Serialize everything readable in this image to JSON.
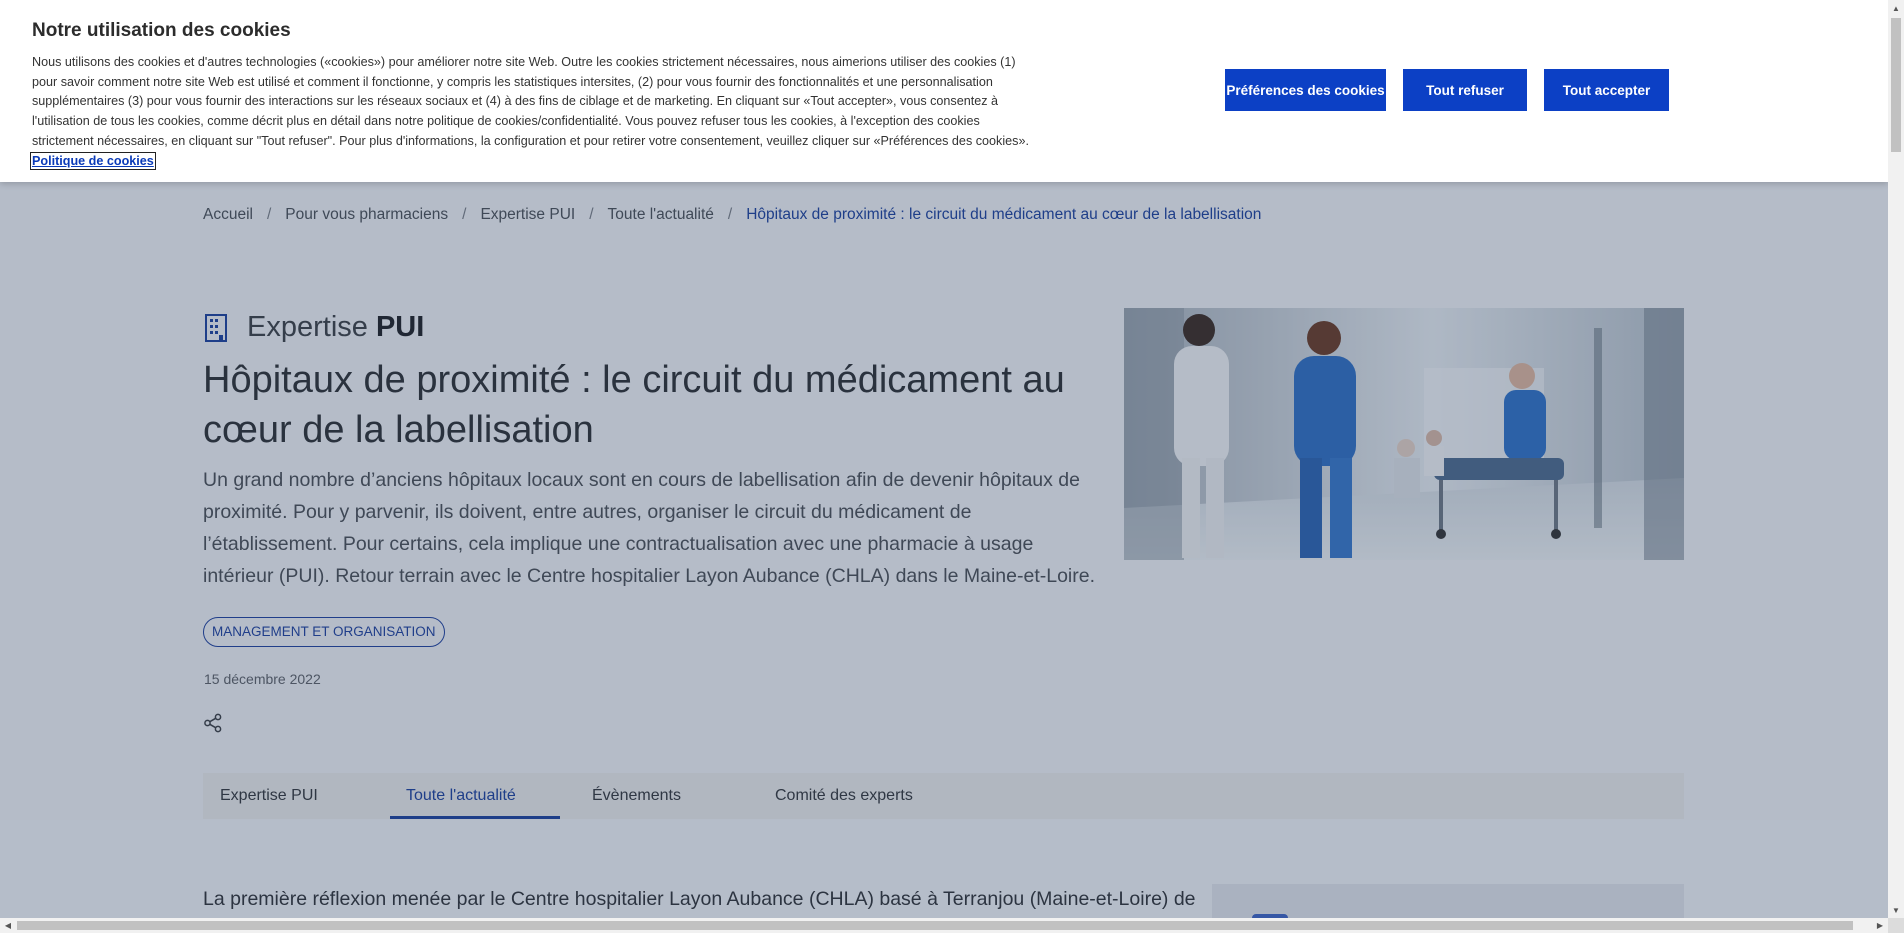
{
  "cookie_banner": {
    "title": "Notre utilisation des cookies",
    "text": "Nous utilisons des cookies et d'autres technologies («cookies») pour améliorer notre site Web. Outre les cookies strictement nécessaires, nous aimerions utiliser des cookies (1) pour savoir comment notre site Web est utilisé et comment il fonctionne, y compris les statistiques intersites, (2) pour vous fournir des fonctionnalités et une personnalisation supplémentaires (3) pour vous fournir des interactions sur les réseaux sociaux et (4) à des fins de ciblage et de marketing. En cliquant sur «Tout accepter», vous consentez à l'utilisation de tous les cookies, comme décrit plus en détail dans notre politique de cookies/confidentialité. Vous pouvez refuser tous les cookies, à l'exception des cookies strictement nécessaires, en cliquant sur \"Tout refuser\". Pour plus d'informations, la configuration et pour retirer votre consentement, veuillez cliquer sur «Préférences des cookies».",
    "policy_link": "Politique de cookies",
    "btn_preferences": "Préférences des cookies",
    "btn_refuse": "Tout refuser",
    "btn_accept": "Tout accepter"
  },
  "breadcrumb": {
    "items": [
      "Accueil",
      "Pour vous pharmaciens",
      "Expertise PUI",
      "Toute l'actualité"
    ],
    "current": "Hôpitaux de proximité : le circuit du médicament au cœur de la labellisation",
    "separator": "/"
  },
  "article": {
    "category_prefix": "Expertise",
    "category_strong": "PUI",
    "title": "Hôpitaux de proximité : le circuit du médicament au cœur de la labellisation",
    "lead": "Un grand nombre d’anciens hôpitaux locaux sont en cours de labellisation afin de devenir hôpitaux de proximité. Pour y parvenir, ils doivent, entre autres, organiser le circuit du médicament de l’établissement. Pour certains, cela implique une contractualisation avec une pharmacie à usage intérieur (PUI). Retour terrain avec le Centre hospitalier Layon Aubance (CHLA) dans le Maine-et-Loire.",
    "tag": "MANAGEMENT ET ORGANISATION",
    "date": "15 décembre 2022",
    "body_start": "La première réflexion menée par le Centre hospitalier Layon Aubance (CHLA) basé à Terranjou (Maine-et-Loire) de"
  },
  "tabs": [
    {
      "label": "Expertise PUI",
      "active": false
    },
    {
      "label": "Toute l'actualité",
      "active": true
    },
    {
      "label": "Évènements",
      "active": false
    },
    {
      "label": "Comité des experts",
      "active": false
    }
  ],
  "colors": {
    "accent": "#0c40c5",
    "link": "#1b3f9e",
    "overlay": "rgba(40,60,90,0.30)"
  },
  "icons": {
    "category": "building-icon",
    "share": "share-icon"
  }
}
